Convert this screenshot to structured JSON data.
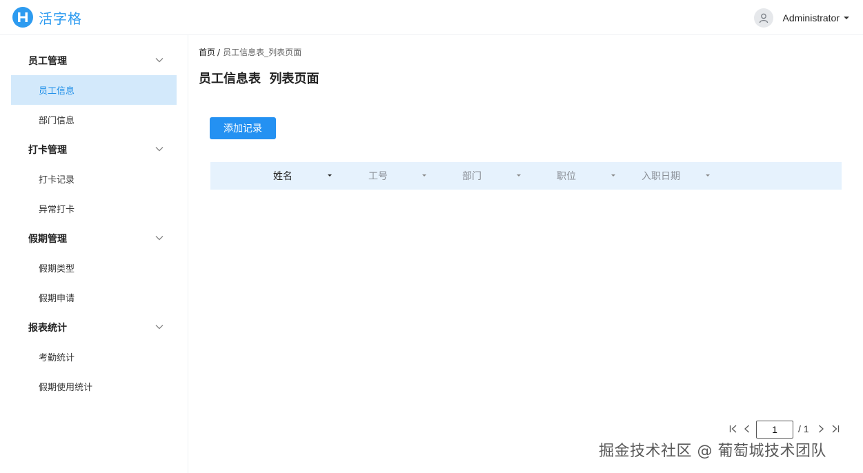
{
  "header": {
    "app_name": "活字格",
    "user_name": "Administrator"
  },
  "sidebar": {
    "groups": [
      {
        "title": "员工管理",
        "items": [
          "员工信息",
          "部门信息"
        ]
      },
      {
        "title": "打卡管理",
        "items": [
          "打卡记录",
          "异常打卡"
        ]
      },
      {
        "title": "假期管理",
        "items": [
          "假期类型",
          "假期申请"
        ]
      },
      {
        "title": "报表统计",
        "items": [
          "考勤统计",
          "假期使用统计"
        ]
      }
    ],
    "active_item": "员工信息"
  },
  "breadcrumb": {
    "home": "首页",
    "separator": "/",
    "current": "员工信息表_列表页面"
  },
  "page": {
    "title": "员工信息表  列表页面",
    "add_button": "添加记录"
  },
  "table": {
    "columns": [
      "姓名",
      "工号",
      "部门",
      "职位",
      "入职日期"
    ],
    "active_sort_column": "姓名"
  },
  "pagination": {
    "current_page": "1",
    "total": "/ 1"
  },
  "watermark": "掘金技术社区 @ 葡萄城技术团队",
  "colors": {
    "accent": "#2491f2",
    "active_menu_bg": "#d3e9fb",
    "table_header_bg": "#e6f2fd"
  }
}
